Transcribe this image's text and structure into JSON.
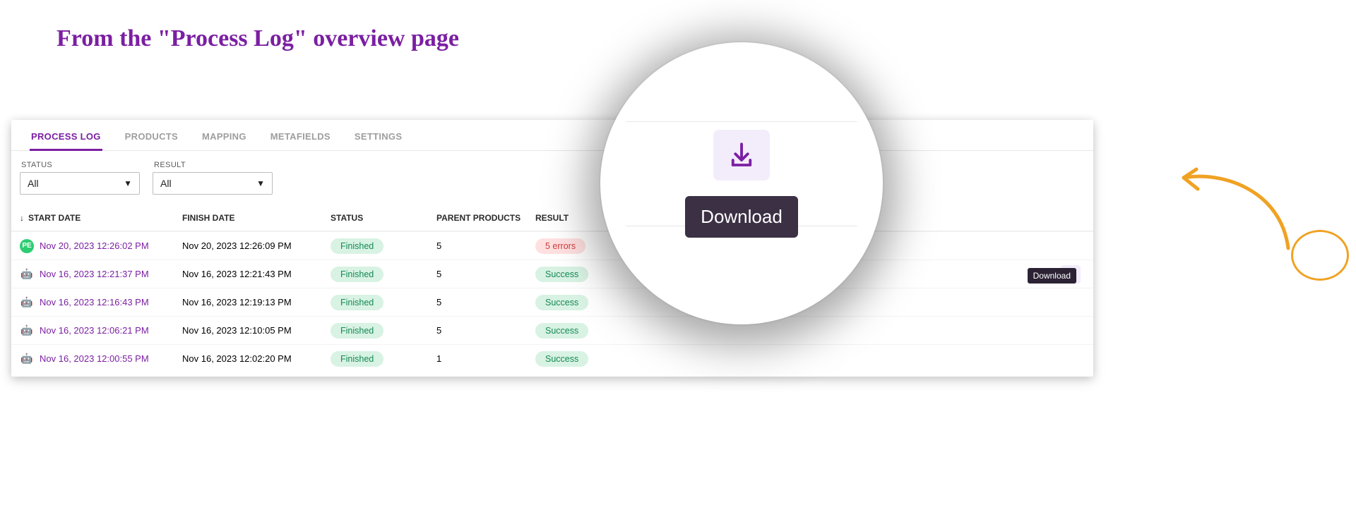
{
  "page_title": "From the \"Process Log\" overview page",
  "tabs": [
    "PROCESS LOG",
    "PRODUCTS",
    "MAPPING",
    "METAFIELDS",
    "SETTINGS"
  ],
  "active_tab_index": 0,
  "filters": {
    "status": {
      "label": "STATUS",
      "value": "All"
    },
    "result": {
      "label": "RESULT",
      "value": "All"
    }
  },
  "columns": {
    "start_date": "START DATE",
    "finish_date": "FINISH DATE",
    "status": "STATUS",
    "parent_products": "PARENT PRODUCTS",
    "result": "RESULT"
  },
  "rows": [
    {
      "avatar": "pe",
      "avatar_text": "PE",
      "start": "Nov 20, 2023 12:26:02 PM",
      "finish": "Nov 20, 2023 12:26:09 PM",
      "status": "Finished",
      "parent_products": "5",
      "result_text": "5 errors",
      "result_kind": "errors",
      "download": false
    },
    {
      "avatar": "bot",
      "start": "Nov 16, 2023 12:21:37 PM",
      "finish": "Nov 16, 2023 12:21:43 PM",
      "status": "Finished",
      "parent_products": "5",
      "result_text": "Success",
      "result_kind": "success",
      "download": true
    },
    {
      "avatar": "bot",
      "start": "Nov 16, 2023 12:16:43 PM",
      "finish": "Nov 16, 2023 12:19:13 PM",
      "status": "Finished",
      "parent_products": "5",
      "result_text": "Success",
      "result_kind": "success",
      "download": false
    },
    {
      "avatar": "bot",
      "start": "Nov 16, 2023 12:06:21 PM",
      "finish": "Nov 16, 2023 12:10:05 PM",
      "status": "Finished",
      "parent_products": "5",
      "result_text": "Success",
      "result_kind": "success",
      "download": false
    },
    {
      "avatar": "bot",
      "start": "Nov 16, 2023 12:00:55 PM",
      "finish": "Nov 16, 2023 12:02:20 PM",
      "status": "Finished",
      "parent_products": "1",
      "result_text": "Success",
      "result_kind": "success",
      "download": false
    }
  ],
  "tooltip_text": "Download",
  "lens_tooltip_text": "Download",
  "colors": {
    "accent": "#7b1fa2",
    "annotation": "#f0a224"
  }
}
